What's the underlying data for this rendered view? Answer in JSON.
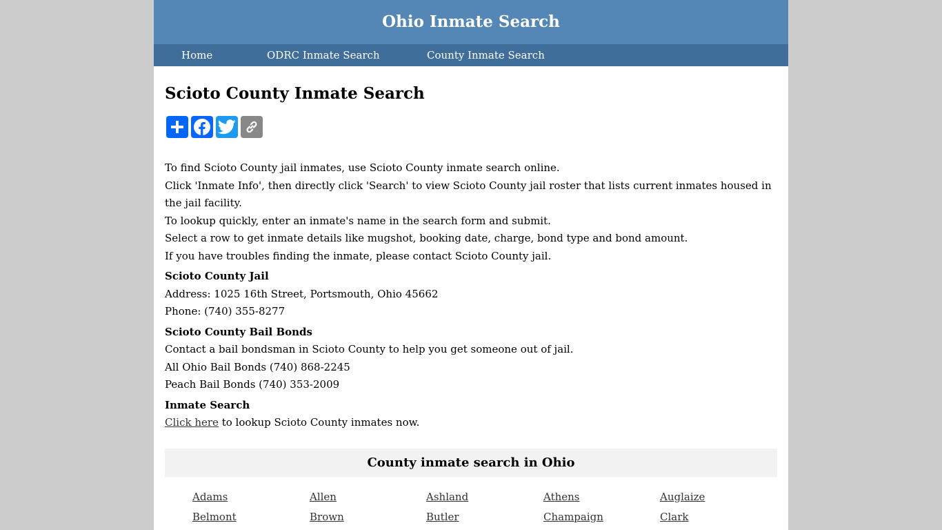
{
  "header": {
    "site_title": "Ohio Inmate Search"
  },
  "nav": {
    "items": [
      {
        "label": "Home"
      },
      {
        "label": "ODRC Inmate Search"
      },
      {
        "label": "County Inmate Search"
      }
    ]
  },
  "main": {
    "title": "Scioto County Inmate Search",
    "share_buttons": [
      {
        "name": "share",
        "icon": "plus-icon",
        "color": "#0166ff"
      },
      {
        "name": "facebook",
        "icon": "facebook-icon",
        "color": "#0866ff"
      },
      {
        "name": "twitter",
        "icon": "twitter-icon",
        "color": "#1d9bf0"
      },
      {
        "name": "copy-link",
        "icon": "link-icon",
        "color": "#888888"
      }
    ],
    "intro": [
      "To find Scioto County jail inmates, use Scioto County inmate search online.",
      "Click 'Inmate Info', then directly click 'Search' to view Scioto County jail roster that lists current inmates housed in the jail facility.",
      "To lookup quickly, enter an inmate's name in the search form and submit.",
      "Select a row to get inmate details like mugshot, booking date, charge, bond type and bond amount.",
      "If you have troubles finding the inmate, please contact Scioto County jail."
    ],
    "jail": {
      "heading": "Scioto County Jail",
      "address": "Address: 1025 16th Street, Portsmouth, Ohio 45662",
      "phone": "Phone: (740) 355-8277"
    },
    "bail_bonds": {
      "heading": "Scioto County Bail Bonds",
      "description": "Contact a bail bondsman in Scioto County to help you get someone out of jail.",
      "items": [
        "All Ohio Bail Bonds (740) 868-2245",
        "Peach Bail Bonds (740) 353-2009"
      ]
    },
    "inmate_search": {
      "heading": "Inmate Search",
      "link_text": "Click here",
      "rest_text": " to lookup Scioto County inmates now."
    }
  },
  "counties": {
    "heading": "County inmate search in Ohio",
    "items": [
      "Adams",
      "Allen",
      "Ashland",
      "Athens",
      "Auglaize",
      "Belmont",
      "Brown",
      "Butler",
      "Champaign",
      "Clark"
    ]
  },
  "colors": {
    "header_bg": "#5487b5",
    "nav_bg": "#3f6e9a",
    "page_bg": "#cccccc",
    "county_box_bg": "#f2f2f2"
  }
}
